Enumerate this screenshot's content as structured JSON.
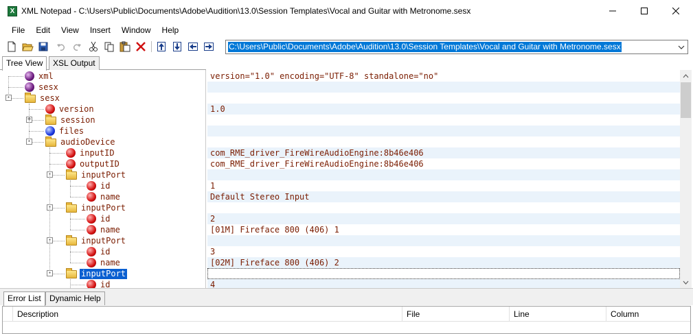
{
  "window": {
    "title": "XML Notepad - C:\\Users\\Public\\Documents\\Adobe\\Audition\\13.0\\Session Templates\\Vocal and Guitar with Metronome.sesx",
    "app_icon_letter": "X"
  },
  "menu": [
    "File",
    "Edit",
    "View",
    "Insert",
    "Window",
    "Help"
  ],
  "toolbar": {
    "icons": [
      "new-file-icon",
      "open-folder-icon",
      "save-icon",
      "undo-icon",
      "redo-icon",
      "cut-icon",
      "copy-icon",
      "paste-icon",
      "delete-icon",
      "nudge-up-icon",
      "nudge-down-icon",
      "nudge-left-icon",
      "nudge-right-icon"
    ],
    "path": "C:\\Users\\Public\\Documents\\Adobe\\Audition\\13.0\\Session Templates\\Vocal and Guitar with Metronome.sesx"
  },
  "tabs_top": [
    "Tree View",
    "XSL Output"
  ],
  "tree": [
    {
      "label": "xml",
      "icon": "purple",
      "depth": 1,
      "expander": ""
    },
    {
      "label": "sesx",
      "icon": "purple",
      "depth": 1,
      "expander": ""
    },
    {
      "label": "sesx",
      "icon": "folder",
      "depth": 1,
      "expander": "-"
    },
    {
      "label": "version",
      "icon": "red",
      "depth": 2,
      "expander": ""
    },
    {
      "label": "session",
      "icon": "folder",
      "depth": 2,
      "expander": "+"
    },
    {
      "label": "files",
      "icon": "blue",
      "depth": 2,
      "expander": ""
    },
    {
      "label": "audioDevice",
      "icon": "folder",
      "depth": 2,
      "expander": "-"
    },
    {
      "label": "inputID",
      "icon": "red",
      "depth": 3,
      "expander": ""
    },
    {
      "label": "outputID",
      "icon": "red",
      "depth": 3,
      "expander": ""
    },
    {
      "label": "inputPort",
      "icon": "folder",
      "depth": 3,
      "expander": "-"
    },
    {
      "label": "id",
      "icon": "red",
      "depth": 4,
      "expander": ""
    },
    {
      "label": "name",
      "icon": "red",
      "depth": 4,
      "expander": ""
    },
    {
      "label": "inputPort",
      "icon": "folder",
      "depth": 3,
      "expander": "-"
    },
    {
      "label": "id",
      "icon": "red",
      "depth": 4,
      "expander": ""
    },
    {
      "label": "name",
      "icon": "red",
      "depth": 4,
      "expander": ""
    },
    {
      "label": "inputPort",
      "icon": "folder",
      "depth": 3,
      "expander": "-"
    },
    {
      "label": "id",
      "icon": "red",
      "depth": 4,
      "expander": ""
    },
    {
      "label": "name",
      "icon": "red",
      "depth": 4,
      "expander": ""
    },
    {
      "label": "inputPort",
      "icon": "folder",
      "depth": 3,
      "expander": "-",
      "selected": true
    },
    {
      "label": "id",
      "icon": "red",
      "depth": 4,
      "expander": ""
    }
  ],
  "values": [
    "version=\"1.0\" encoding=\"UTF-8\" standalone=\"no\"",
    "",
    "",
    "1.0",
    "",
    "",
    "",
    "com_RME_driver_FireWireAudioEngine:8b46e406",
    "com_RME_driver_FireWireAudioEngine:8b46e406",
    "",
    "1",
    "Default Stereo Input",
    "",
    "2",
    "[01M] Fireface 800 (406) 1",
    "",
    "3",
    "[02M] Fireface 800 (406) 2",
    "",
    "4"
  ],
  "tabs_bottom": [
    "Error List",
    "Dynamic Help"
  ],
  "error_grid": {
    "columns": [
      "Description",
      "File",
      "Line",
      "Column"
    ]
  },
  "colors": {
    "selection": "#0a5fd1",
    "value_text": "#7a1c00",
    "tree_text": "#7a1c00",
    "row_alt": "#eaf3fb"
  }
}
